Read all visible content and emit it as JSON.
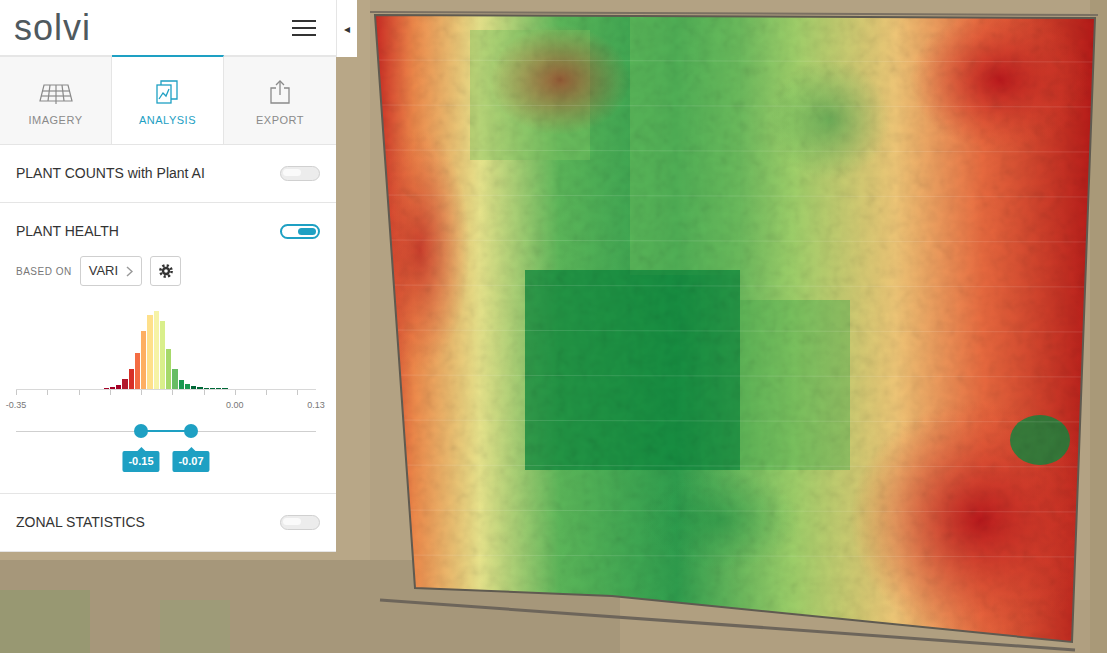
{
  "logo": "solvi",
  "collapse_glyph": "◂",
  "tabs": [
    {
      "label": "IMAGERY",
      "selected": false
    },
    {
      "label": "ANALYSIS",
      "selected": true
    },
    {
      "label": "EXPORT",
      "selected": false
    }
  ],
  "sections": [
    {
      "title": "PLANT COUNTS with Plant AI",
      "on": false
    },
    {
      "title": "PLANT HEALTH",
      "on": true
    },
    {
      "title": "ZONAL STATISTICS",
      "on": false
    }
  ],
  "plant_health": {
    "based_on_label": "BASED ON",
    "index": "VARI",
    "histogram": {
      "axis": {
        "min": -0.35,
        "max": 0.13
      },
      "ticks": [
        {
          "label": "-0.35",
          "value": -0.35
        },
        {
          "label": "0.00",
          "value": 0.0
        },
        {
          "label": "0.13",
          "value": 0.13
        }
      ],
      "bins": [
        {
          "start": -0.21,
          "count": 1,
          "color": "#a50026"
        },
        {
          "start": -0.2,
          "count": 2,
          "color": "#a50026"
        },
        {
          "start": -0.19,
          "count": 4,
          "color": "#a50026"
        },
        {
          "start": -0.18,
          "count": 10,
          "color": "#b2182b"
        },
        {
          "start": -0.17,
          "count": 20,
          "color": "#d73027"
        },
        {
          "start": -0.16,
          "count": 36,
          "color": "#f46d43"
        },
        {
          "start": -0.15,
          "count": 58,
          "color": "#fdae61"
        },
        {
          "start": -0.14,
          "count": 74,
          "color": "#fee08b"
        },
        {
          "start": -0.13,
          "count": 78,
          "color": "#f6f3a6"
        },
        {
          "start": -0.12,
          "count": 68,
          "color": "#d9ef8b"
        },
        {
          "start": -0.11,
          "count": 40,
          "color": "#a6d96a"
        },
        {
          "start": -0.1,
          "count": 20,
          "color": "#66bd63"
        },
        {
          "start": -0.09,
          "count": 9,
          "color": "#1a9850"
        },
        {
          "start": -0.08,
          "count": 5,
          "color": "#1a9850"
        },
        {
          "start": -0.07,
          "count": 3,
          "color": "#006837"
        },
        {
          "start": -0.06,
          "count": 2,
          "color": "#006837"
        },
        {
          "start": -0.05,
          "count": 1,
          "color": "#006837"
        },
        {
          "start": -0.04,
          "count": 1,
          "color": "#006837"
        },
        {
          "start": -0.03,
          "count": 1,
          "color": "#006837"
        },
        {
          "start": -0.02,
          "count": 1,
          "color": "#006837"
        }
      ]
    },
    "slider": {
      "low": -0.15,
      "high": -0.07,
      "low_label": "-0.15",
      "high_label": "-0.07"
    }
  }
}
